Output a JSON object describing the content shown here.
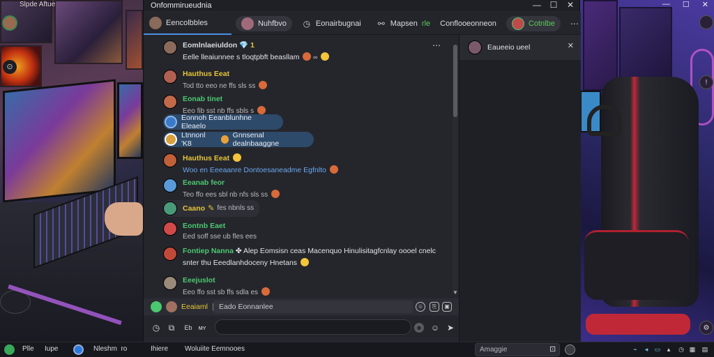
{
  "desktop": {
    "corner_user": "Slpde Aftue",
    "corner_icon": "⊙"
  },
  "window": {
    "title": "Onfommirueudnia",
    "controls": {
      "minimize": "—",
      "maximize": "☐",
      "close": "✕"
    }
  },
  "tabs": [
    {
      "label": "Eencolbbles",
      "icon": "avatar",
      "active": true
    },
    {
      "label": "Nuhfbvo",
      "icon": "avatar",
      "pill": true
    },
    {
      "label": "Eonairbugnai",
      "icon": "clock-icon"
    },
    {
      "label": "Mapsen",
      "icon": "link-icon",
      "suffix": "rle"
    },
    {
      "label": "Conflooeonneon",
      "icon": ""
    },
    {
      "label": "Cotnlbe",
      "icon": "avatar",
      "pill": true,
      "green": true
    },
    {
      "label": "⋯",
      "icon": "more-icon"
    }
  ],
  "messages": [
    {
      "name": "Eomlnlaeiuldon",
      "name_suffix": "💎 1",
      "text": "Eelle lleaiunnee s tloqtpbft beasllam",
      "name_color": "#d8dbe0",
      "avatar": "#8a6a5a",
      "text_big": true
    },
    {
      "name": "Hauthus Eeat",
      "text": "Tod tto eeo ne ffs sls ss",
      "name_color": "#e3c43a",
      "avatar": "#b06050"
    },
    {
      "name": "Eonab tinet",
      "text": "Eeo fib sst nb ffs sbls s",
      "name_color": "#4cc870",
      "avatar": "#c06a4a"
    },
    {
      "name": "Eonnoh Eeanblunhne Eleaelo",
      "bubble": true,
      "avatar": "#3a7ac8"
    },
    {
      "name": "Ltnnonl 'K8",
      "name_suffix": "Gnnsenal dealnbaaggne",
      "bubble": true,
      "avatar": "#d9a040",
      "green": true
    },
    {
      "name": "Hauthus Eeat",
      "text": "Woo en Eeeaanre Dontoesaneadme Egfnlto",
      "name_color": "#e3c43a",
      "avatar": "#c0603a",
      "text_blue": true
    },
    {
      "name": "Eeanab feor",
      "text": "Teo ffo ees sbl nb nfs sls ss",
      "name_color": "#4cc870",
      "avatar": "#5a9ad8"
    },
    {
      "name": "Caano",
      "text": "fes nbnls ss",
      "name_color": "#e3c43a",
      "avatar": "#4a9a7a",
      "short": true
    },
    {
      "name": "Eontnb Eaet",
      "text": "Eed soff sse ub fles ees",
      "name_color": "#4cc870",
      "avatar": "#d04a4a"
    },
    {
      "name": "Fontiep Nanna",
      "name_suffix": "✤ Alep Eomsisn ceas Macenquo Hinulisitagfcnlay oooel cnelc",
      "text": "snter thu Eeedlanhdoceny Hnetans",
      "name_color": "#4cc870",
      "avatar": "#c04a3a",
      "text_big": true
    },
    {
      "name": "Eeejuslot",
      "text": "Eeo ffo sst sb ffs sdla es",
      "name_color": "#4cc870",
      "avatar": "#9a8a7a"
    }
  ],
  "reply": {
    "name": "Eeaiaml",
    "sep": "|",
    "text": "Eado Eonnanlee"
  },
  "composer": {
    "placeholder": "",
    "icons": [
      "clock-icon",
      "image-icon",
      "gif-icon",
      "mention-icon"
    ],
    "gif_label": "Eb",
    "mention_label": "ᴍʏ"
  },
  "side_panel": {
    "title": "Eaueeio ueel"
  },
  "taskbar": {
    "start_label": "Plle",
    "item2": "Iupe",
    "item3": "Nleshm",
    "item3_suffix": "ro",
    "item4": "Ihiere",
    "item5": "Woluiite Eemnooes",
    "search_placeholder": "Amaggie"
  }
}
